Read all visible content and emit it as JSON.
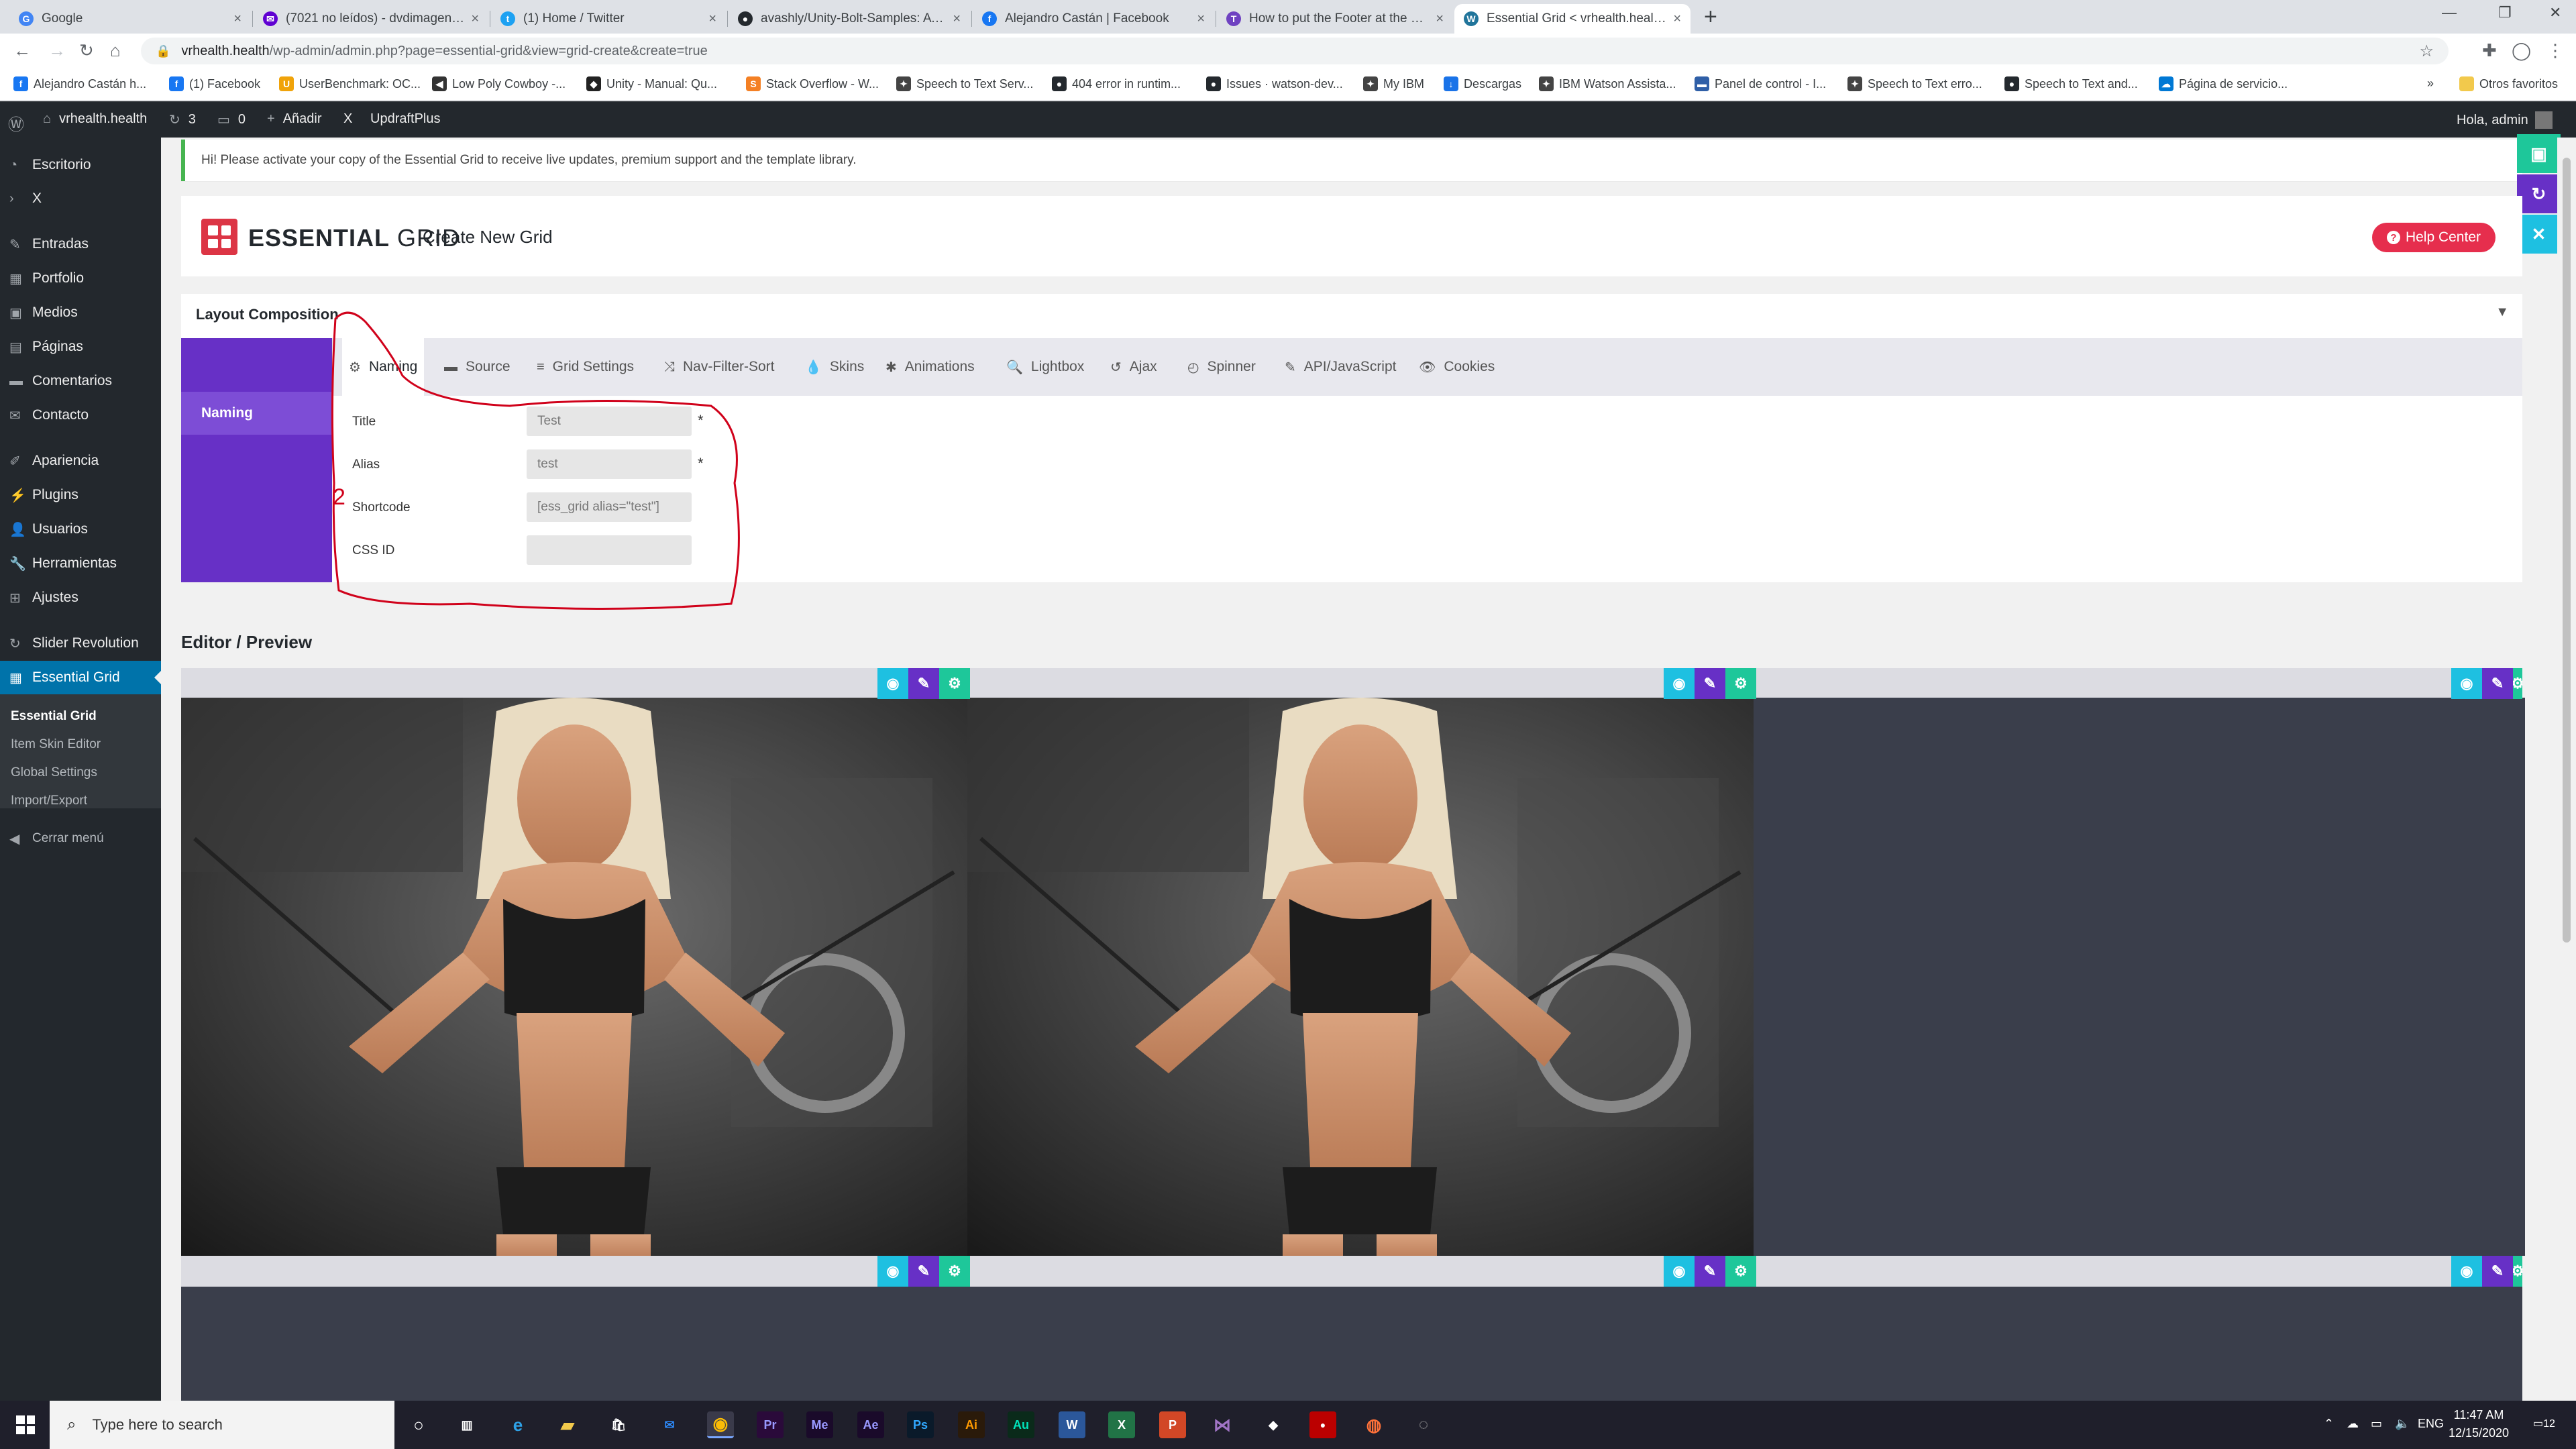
{
  "browser": {
    "tabs": [
      {
        "label": "Google",
        "icon": "google-icon",
        "color": "#4285f4",
        "glyph": "G"
      },
      {
        "label": "(7021 no leídos) - dvdimagen@y...",
        "icon": "yahoo-mail-icon",
        "color": "#6001d2",
        "glyph": "✉"
      },
      {
        "label": "(1) Home / Twitter",
        "icon": "twitter-icon",
        "color": "#1da1f2",
        "glyph": "t"
      },
      {
        "label": "avashly/Unity-Bolt-Samples: A co...",
        "icon": "github-icon",
        "color": "#24292e",
        "glyph": "●"
      },
      {
        "label": "Alejandro Castán | Facebook",
        "icon": "facebook-icon",
        "color": "#1877f2",
        "glyph": "f"
      },
      {
        "label": "How to put the Footer at the Pag...",
        "icon": "site-icon",
        "color": "#6f42c1",
        "glyph": "T"
      },
      {
        "label": "Essential Grid < vrhealth.health —",
        "icon": "wordpress-icon",
        "color": "#21759b",
        "glyph": "W"
      }
    ],
    "url_host": "vrhealth.health",
    "url_path": "/wp-admin/admin.php?page=essential-grid&view=grid-create&create=true",
    "bookmarks": [
      {
        "label": "Alejandro Castán h...",
        "color": "#1877f2",
        "glyph": "f"
      },
      {
        "label": "(1) Facebook",
        "color": "#1877f2",
        "glyph": "f"
      },
      {
        "label": "UserBenchmark: OC...",
        "color": "#f0a30a",
        "glyph": "U"
      },
      {
        "label": "Low Poly Cowboy -...",
        "color": "#333333",
        "glyph": "◀"
      },
      {
        "label": "Unity - Manual: Qu...",
        "color": "#222222",
        "glyph": "◆"
      },
      {
        "label": "Stack Overflow - W...",
        "color": "#f48024",
        "glyph": "S"
      },
      {
        "label": "Speech to Text Serv...",
        "color": "#444444",
        "glyph": "✦"
      },
      {
        "label": "404 error in runtim...",
        "color": "#24292e",
        "glyph": "●"
      },
      {
        "label": "Issues · watson-dev...",
        "color": "#24292e",
        "glyph": "●"
      },
      {
        "label": "My IBM",
        "color": "#444444",
        "glyph": "✦"
      },
      {
        "label": "Descargas",
        "color": "#1a73e8",
        "glyph": "↓"
      },
      {
        "label": "IBM Watson Assista...",
        "color": "#444444",
        "glyph": "✦"
      },
      {
        "label": "Panel de control - I...",
        "color": "#2f5fa7",
        "glyph": "▬"
      },
      {
        "label": "Speech to Text erro...",
        "color": "#444444",
        "glyph": "✦"
      },
      {
        "label": "Speech to Text and...",
        "color": "#24292e",
        "glyph": "●"
      },
      {
        "label": "Página de servicio...",
        "color": "#0078d4",
        "glyph": "☁"
      }
    ],
    "more_bookmarks": "»",
    "other_favorites": "Otros favoritos"
  },
  "adminbar": {
    "site": "vrhealth.health",
    "updates": "3",
    "comments": "0",
    "new": "Añadir",
    "x": "X",
    "updraft": "UpdraftPlus",
    "greeting": "Hola, admin"
  },
  "sidebar": {
    "items": [
      {
        "label": "Escritorio",
        "icon": "dashboard-icon",
        "glyph": "◔"
      },
      {
        "label": "X",
        "icon": "chevron-right-icon",
        "glyph": "›"
      },
      {
        "label": "Entradas",
        "icon": "pin-icon",
        "glyph": "✎"
      },
      {
        "label": "Portfolio",
        "icon": "portfolio-icon",
        "glyph": "▦"
      },
      {
        "label": "Medios",
        "icon": "media-icon",
        "glyph": "▣"
      },
      {
        "label": "Páginas",
        "icon": "pages-icon",
        "glyph": "▤"
      },
      {
        "label": "Comentarios",
        "icon": "comments-icon",
        "glyph": "▬"
      },
      {
        "label": "Contacto",
        "icon": "contact-icon",
        "glyph": "✉"
      },
      {
        "label": "Apariencia",
        "icon": "appearance-icon",
        "glyph": "✐"
      },
      {
        "label": "Plugins",
        "icon": "plugins-icon",
        "glyph": "⚡"
      },
      {
        "label": "Usuarios",
        "icon": "users-icon",
        "glyph": "👤"
      },
      {
        "label": "Herramientas",
        "icon": "tools-icon",
        "glyph": "🔧"
      },
      {
        "label": "Ajustes",
        "icon": "settings-icon",
        "glyph": "⊞"
      },
      {
        "label": "Slider Revolution",
        "icon": "slider-revolution-icon",
        "glyph": "↻"
      },
      {
        "label": "Essential Grid",
        "icon": "essential-grid-icon",
        "glyph": "▦"
      }
    ],
    "submenu": [
      "Essential Grid",
      "Item Skin Editor",
      "Global Settings",
      "Import/Export"
    ],
    "collapse": "Cerrar menú"
  },
  "notice": "Hi! Please activate your copy of the Essential Grid to receive live updates, premium support and the template library.",
  "header": {
    "logo_bold": "ESSENTIAL",
    "logo_thin": " GRID",
    "title": "Create New Grid",
    "help": "Help Center"
  },
  "layout": {
    "title": "Layout Composition",
    "side_active": "Naming",
    "tabs": [
      {
        "label": "Naming",
        "glyph": "⚙"
      },
      {
        "label": "Source",
        "glyph": "▬"
      },
      {
        "label": "Grid Settings",
        "glyph": "≡"
      },
      {
        "label": "Nav-Filter-Sort",
        "glyph": "⤨"
      },
      {
        "label": "Skins",
        "glyph": "💧"
      },
      {
        "label": "Animations",
        "glyph": "✱"
      },
      {
        "label": "Lightbox",
        "glyph": "🔍"
      },
      {
        "label": "Ajax",
        "glyph": "↺"
      },
      {
        "label": "Spinner",
        "glyph": "◴"
      },
      {
        "label": "API/JavaScript",
        "glyph": "✎"
      },
      {
        "label": "Cookies",
        "glyph": "👁"
      }
    ],
    "fields": {
      "title_label": "Title",
      "title_value": "Test",
      "alias_label": "Alias",
      "alias_value": "test",
      "shortcode_label": "Shortcode",
      "shortcode_value": "[ess_grid alias=\"test\"]",
      "cssid_label": "CSS ID",
      "cssid_value": "",
      "required_mark": "*"
    }
  },
  "annotation": {
    "number": "2",
    "color": "#d0021b"
  },
  "editor": {
    "title": "Editor / Preview"
  },
  "taskbar": {
    "search_placeholder": "Type here to search",
    "lang": "ENG",
    "time": "11:47 AM",
    "date": "12/15/2020",
    "notifications": "12"
  },
  "colors": {
    "wp_blue": "#0073aa",
    "eg_purple": "#6730c6",
    "eg_red": "#e62e4d",
    "eg_teal": "#1ec79a",
    "eg_cyan": "#1ec0e1"
  }
}
